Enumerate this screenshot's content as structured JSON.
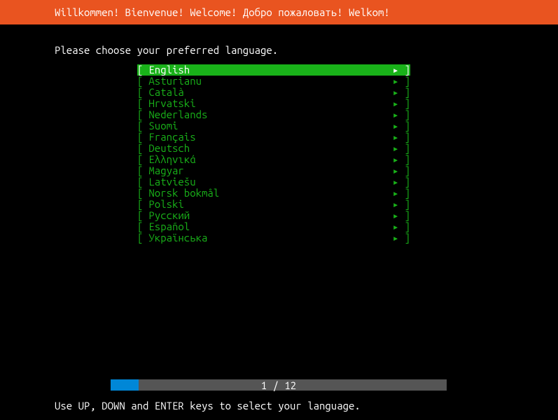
{
  "header": {
    "title": "Willkommen! Bienvenue! Welcome! Добро пожаловать! Welkom!"
  },
  "prompt": "Please choose your preferred language.",
  "languages": [
    {
      "name": "English",
      "selected": true
    },
    {
      "name": "Asturianu",
      "selected": false
    },
    {
      "name": "Català",
      "selected": false
    },
    {
      "name": "Hrvatski",
      "selected": false
    },
    {
      "name": "Nederlands",
      "selected": false
    },
    {
      "name": "Suomi",
      "selected": false
    },
    {
      "name": "Français",
      "selected": false
    },
    {
      "name": "Deutsch",
      "selected": false
    },
    {
      "name": "Ελληνικά",
      "selected": false
    },
    {
      "name": "Magyar",
      "selected": false
    },
    {
      "name": "Latviešu",
      "selected": false
    },
    {
      "name": "Norsk bokmål",
      "selected": false
    },
    {
      "name": "Polski",
      "selected": false
    },
    {
      "name": "Русский",
      "selected": false
    },
    {
      "name": "Español",
      "selected": false
    },
    {
      "name": "Українська",
      "selected": false
    }
  ],
  "progress": {
    "current": "1",
    "total": "12",
    "separator": " / ",
    "fill_percent": 8.33
  },
  "footer": "Use UP, DOWN and ENTER keys to select your language.",
  "glyphs": {
    "bracket_left": "[",
    "bracket_right": "]",
    "arrow": "▸"
  }
}
